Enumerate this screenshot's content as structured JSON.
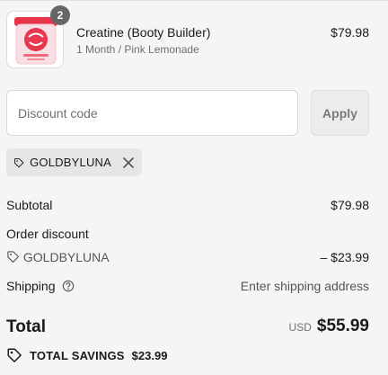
{
  "line_item": {
    "quantity": "2",
    "title": "Creatine (Booty Builder)",
    "variant": "1 Month / Pink Lemonade",
    "price": "$79.98",
    "thumb_icon": "product-jar-image"
  },
  "discount_form": {
    "placeholder": "Discount code",
    "apply_label": "Apply"
  },
  "applied_code": {
    "code": "GOLDBYLUNA",
    "tag_icon": "tag-icon",
    "remove_icon": "close-icon"
  },
  "summary": {
    "subtotal_label": "Subtotal",
    "subtotal_value": "$79.98",
    "order_discount_label": "Order discount",
    "discount_code": "GOLDBYLUNA",
    "discount_value": "– $23.99",
    "shipping_label": "Shipping",
    "shipping_value": "Enter shipping address",
    "help_icon": "question-circle-icon"
  },
  "total": {
    "label": "Total",
    "currency": "USD",
    "amount": "$55.99"
  },
  "savings": {
    "label": "TOTAL SAVINGS",
    "amount": "$23.99",
    "icon": "tag-icon"
  },
  "colors": {
    "background": "#f5f5f5",
    "chip_background": "#e6e6e6",
    "badge": "#666666",
    "product_red": "#e63950"
  }
}
